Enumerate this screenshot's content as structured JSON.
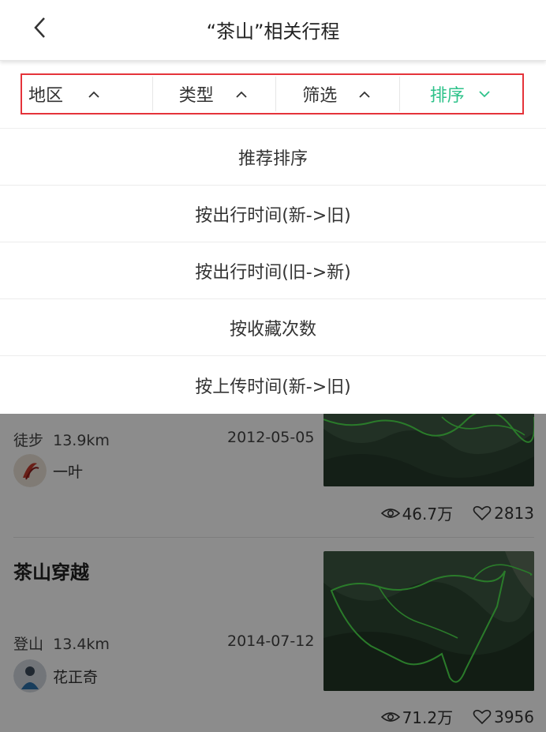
{
  "header": {
    "title": "“茶山”相关行程",
    "back_icon": "chevron-left-icon"
  },
  "filters": [
    {
      "label": "地区",
      "icon": "chevron-up-icon",
      "active": false
    },
    {
      "label": "类型",
      "icon": "chevron-up-icon",
      "active": false
    },
    {
      "label": "筛选",
      "icon": "chevron-up-icon",
      "active": false
    },
    {
      "label": "排序",
      "icon": "chevron-down-icon",
      "active": true
    }
  ],
  "accent_color": "#2ec28a",
  "highlight_color": "#e5333a",
  "sort_options": [
    "推荐排序",
    "按出行时间(新->旧)",
    "按出行时间(旧->新)",
    "按收藏次数",
    "按上传时间(新->旧)"
  ],
  "trips": [
    {
      "title": "",
      "type": "徒步",
      "distance": "13.9km",
      "date": "2012-05-05",
      "author": "一叶",
      "views": "46.7万",
      "likes": "2813"
    },
    {
      "title": "茶山穿越",
      "type": "登山",
      "distance": "13.4km",
      "date": "2014-07-12",
      "author": "花正奇",
      "views": "71.2万",
      "likes": "3956"
    }
  ]
}
